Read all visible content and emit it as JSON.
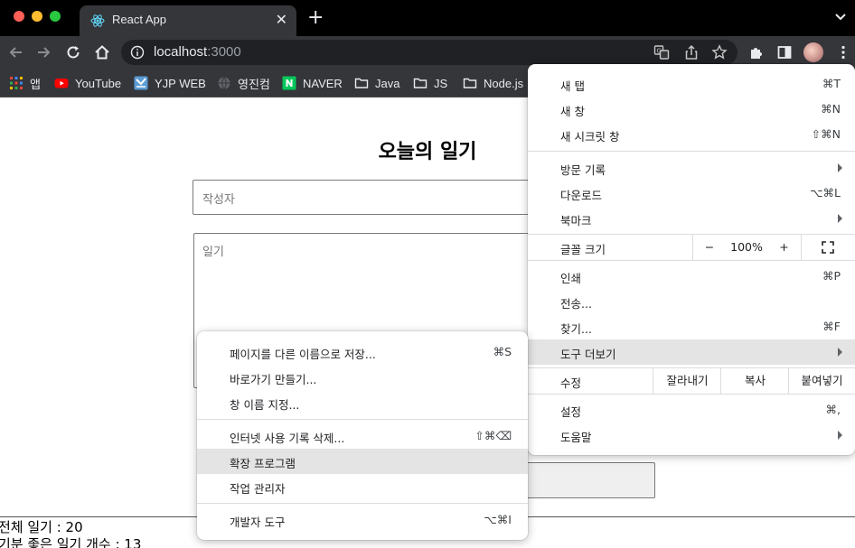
{
  "browser": {
    "tab_title": "React App",
    "url_host": "localhost",
    "url_port": ":3000"
  },
  "bookmarks": [
    {
      "label": "앱",
      "icon": "apps-grid-icon"
    },
    {
      "label": "YouTube",
      "icon": "youtube-icon"
    },
    {
      "label": "YJP WEB",
      "icon": "yjp-web-icon"
    },
    {
      "label": "영진컴",
      "icon": "globe-icon"
    },
    {
      "label": "NAVER",
      "icon": "naver-icon"
    },
    {
      "label": "Java",
      "icon": "folder-icon"
    },
    {
      "label": "JS",
      "icon": "folder-icon"
    },
    {
      "label": "Node.js",
      "icon": "folder-icon"
    }
  ],
  "page": {
    "title": "오늘의 일기",
    "author_placeholder": "작성자",
    "content_placeholder": "일기",
    "total_count": "전체 일기 : 20",
    "good_mood_count": "기분 좋은 일기 개수 : 13"
  },
  "menu": {
    "new_tab": "새 탭",
    "new_tab_short": "⌘T",
    "new_window": "새 창",
    "new_window_short": "⌘N",
    "new_incognito": "새 시크릿 창",
    "new_incognito_short": "⇧⌘N",
    "history": "방문 기록",
    "downloads": "다운로드",
    "downloads_short": "⌥⌘L",
    "bookmarks": "북마크",
    "zoom_label": "글꼴 크기",
    "zoom_minus": "−",
    "zoom_value": "100%",
    "zoom_plus": "+",
    "print": "인쇄",
    "print_short": "⌘P",
    "cast": "전송...",
    "find": "찾기...",
    "find_short": "⌘F",
    "more_tools": "도구 더보기",
    "edit_label": "수정",
    "cut": "잘라내기",
    "copy": "복사",
    "paste": "붙여넣기",
    "settings": "설정",
    "settings_short": "⌘,",
    "help": "도움말"
  },
  "submenu": {
    "save_page": "페이지를 다른 이름으로 저장...",
    "save_page_short": "⌘S",
    "create_shortcut": "바로가기 만들기...",
    "name_window": "창 이름 지정...",
    "clear_data": "인터넷 사용 기록 삭제...",
    "clear_data_short": "⇧⌘⌫",
    "extensions": "확장 프로그램",
    "task_manager": "작업 관리자",
    "dev_tools": "개발자 도구",
    "dev_tools_short": "⌥⌘I"
  }
}
